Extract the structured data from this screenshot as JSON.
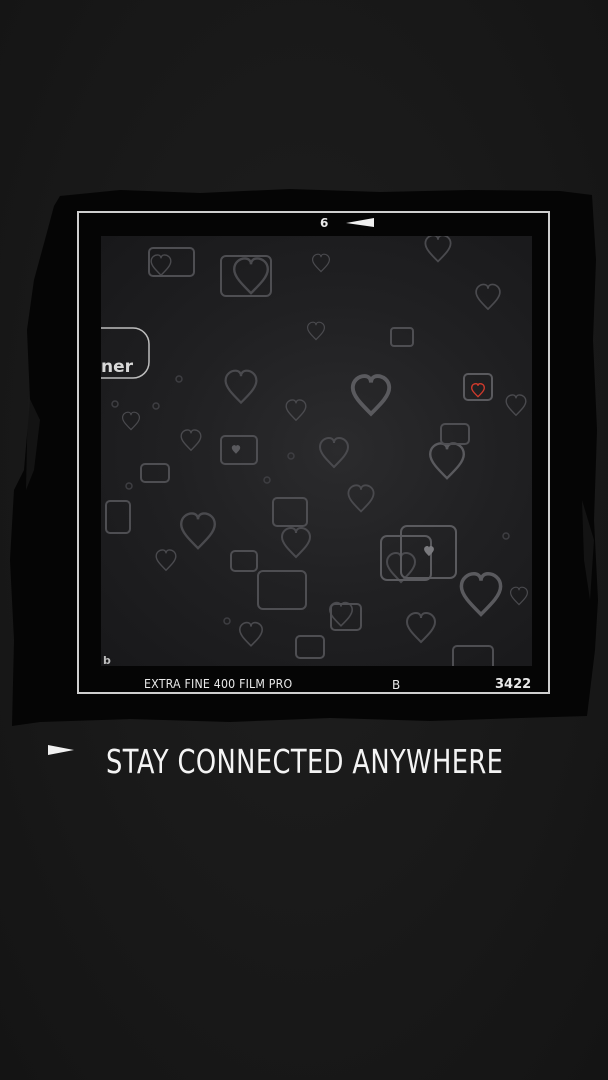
{
  "film": {
    "frame_number": "6",
    "label": "EXTRA FINE 400 FILM PRO",
    "mode": "B",
    "count": "3422",
    "corner_mark": "b"
  },
  "photo": {
    "partial_text": "ner"
  },
  "headline": {
    "text": "STAY CONNECTED ANYWHERE"
  },
  "icons": {
    "frame_arrow": "triangle-left-icon",
    "headline_arrow": "triangle-right-icon",
    "pattern": "heart-icon"
  },
  "colors": {
    "background": "#1a1a1a",
    "frame_border": "#cfcfcf",
    "text": "#f4f4f4",
    "accent_heart": "#d03a2c"
  }
}
